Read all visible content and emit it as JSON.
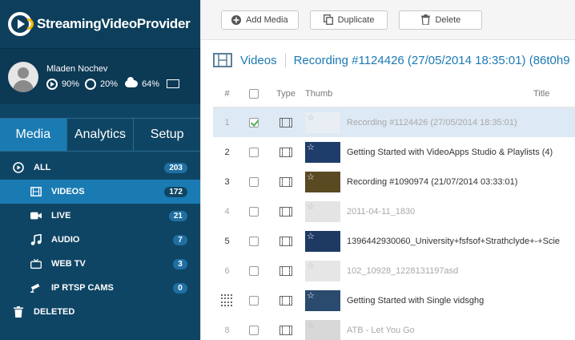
{
  "brand": {
    "name": "StreamingVideoProvider"
  },
  "user": {
    "name": "Mladen Nochev",
    "stat1": "90%",
    "stat2": "20%",
    "stat3": "64%"
  },
  "tabs": [
    {
      "label": "Media",
      "active": true
    },
    {
      "label": "Analytics",
      "active": false
    },
    {
      "label": "Setup",
      "active": false
    }
  ],
  "nav": [
    {
      "label": "ALL",
      "count": "203",
      "icon": "play-circle-icon",
      "sub": false,
      "active": false
    },
    {
      "label": "VIDEOS",
      "count": "172",
      "icon": "film-icon",
      "sub": true,
      "active": true
    },
    {
      "label": "LIVE",
      "count": "21",
      "icon": "camera-icon",
      "sub": true,
      "active": false
    },
    {
      "label": "AUDIO",
      "count": "7",
      "icon": "music-icon",
      "sub": true,
      "active": false
    },
    {
      "label": "WEB TV",
      "count": "3",
      "icon": "tv-icon",
      "sub": true,
      "active": false
    },
    {
      "label": "IP RTSP CAMS",
      "count": "0",
      "icon": "ip-camera-icon",
      "sub": true,
      "active": false
    },
    {
      "label": "DELETED",
      "count": "",
      "icon": "trash-icon",
      "sub": false,
      "active": false
    }
  ],
  "toolbar": {
    "add_media": "Add Media",
    "duplicate": "Duplicate",
    "delete": "Delete"
  },
  "breadcrumb": {
    "section": "Videos",
    "current": "Recording #1124426 (27/05/2014 18:35:01) (86t0h9"
  },
  "table": {
    "headers": {
      "num": "#",
      "type": "Type",
      "thumb": "Thumb",
      "title": "Title"
    },
    "rows": [
      {
        "num": "1",
        "title": "Recording #1124426 (27/05/2014 18:35:01)",
        "checked": true,
        "selected": true,
        "faded": true,
        "thumb_color": "#e8eef3",
        "drag": false
      },
      {
        "num": "2",
        "title": "Getting Started with VideoApps Studio & Playlists (4)",
        "checked": false,
        "selected": false,
        "faded": false,
        "thumb_color": "#1f3d6a",
        "drag": false
      },
      {
        "num": "3",
        "title": "Recording #1090974 (21/07/2014 03:33:01)",
        "checked": false,
        "selected": false,
        "faded": false,
        "thumb_color": "#5a4a22",
        "drag": false
      },
      {
        "num": "4",
        "title": "2011-04-11_1830",
        "checked": false,
        "selected": false,
        "faded": true,
        "thumb_color": "#e4e4e4",
        "drag": false
      },
      {
        "num": "5",
        "title": "1396442930060_University+fsfsof+Strathclyde+-+Scie",
        "checked": false,
        "selected": false,
        "faded": false,
        "thumb_color": "#1e3a63",
        "drag": false
      },
      {
        "num": "6",
        "title": "102_10928_1228131197asd",
        "checked": false,
        "selected": false,
        "faded": true,
        "thumb_color": "#e6e6e6",
        "drag": false
      },
      {
        "num": "",
        "title": "Getting Started with Single vidsghg",
        "checked": false,
        "selected": false,
        "faded": false,
        "thumb_color": "#2a4a6e",
        "drag": true
      },
      {
        "num": "8",
        "title": "ATB - Let You Go",
        "checked": false,
        "selected": false,
        "faded": true,
        "thumb_color": "#d8d8d8",
        "drag": false
      }
    ]
  }
}
